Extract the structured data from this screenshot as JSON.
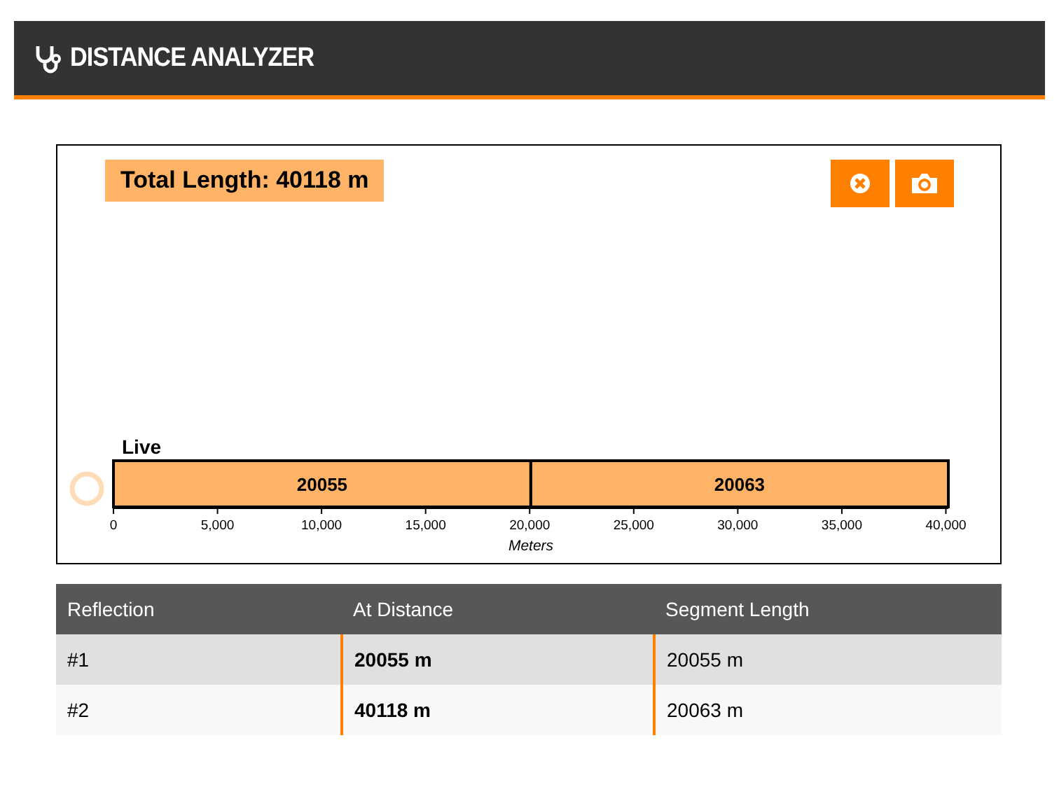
{
  "header": {
    "title": "DISTANCE ANALYZER"
  },
  "panel": {
    "total_label": "Total Length: 40118 m",
    "buttons": [
      {
        "kind": "clear"
      },
      {
        "kind": "camera"
      }
    ],
    "chart_data": {
      "type": "bar",
      "orientation": "horizontal",
      "stacked": true,
      "data_labels": true,
      "xlabel": "Meters",
      "categories": [
        "Live"
      ],
      "series": [
        {
          "color": "#ffb366",
          "values": [
            20055
          ]
        },
        {
          "color": "#ffb366",
          "values": [
            20063
          ]
        }
      ],
      "xlim": [
        0,
        40118
      ],
      "xticks": [
        {
          "value": 0,
          "label": "0"
        },
        {
          "value": 5000,
          "label": "5,000"
        },
        {
          "value": 10000,
          "label": "10,000"
        },
        {
          "value": 15000,
          "label": "15,000"
        },
        {
          "value": 20000,
          "label": "20,000"
        },
        {
          "value": 25000,
          "label": "25,000"
        },
        {
          "value": 30000,
          "label": "30,000"
        },
        {
          "value": 35000,
          "label": "35,000"
        },
        {
          "value": 40000,
          "label": "40,000"
        }
      ]
    }
  },
  "table": {
    "columns": [
      "Reflection",
      "At Distance",
      "Segment Length"
    ],
    "rows": [
      [
        "#1",
        "20055 m",
        "20055 m"
      ],
      [
        "#2",
        "40118 m",
        "20063 m"
      ]
    ]
  }
}
